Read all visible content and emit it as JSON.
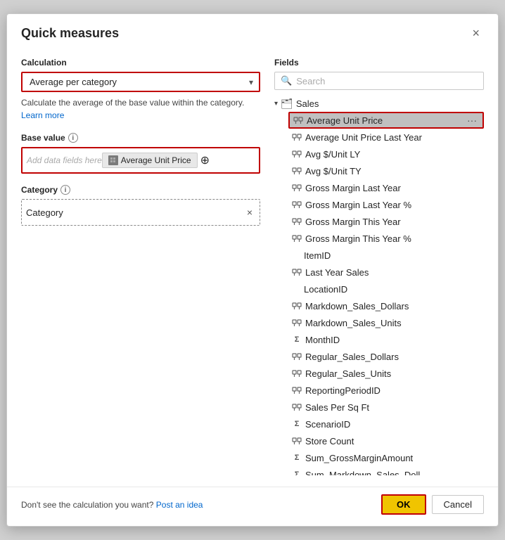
{
  "dialog": {
    "title": "Quick measures",
    "close_label": "×"
  },
  "left": {
    "calculation_label": "Calculation",
    "calculation_value": "Average per category",
    "description": "Calculate the average of the base value within the category.",
    "learn_more": "Learn more",
    "base_value_label": "Base value",
    "base_value_placeholder": "Add data fields here",
    "base_value_chip": "Average Unit Price",
    "category_label": "Category",
    "category_value": "Category"
  },
  "right": {
    "fields_label": "Fields",
    "search_placeholder": "Search",
    "tree": {
      "parent_label": "Sales",
      "items": [
        {
          "id": "avg-unit-price",
          "label": "Average Unit Price",
          "type": "measure",
          "selected": true,
          "show_menu": true
        },
        {
          "id": "avg-unit-price-ly",
          "label": "Average Unit Price Last Year",
          "type": "measure",
          "selected": false
        },
        {
          "id": "avg-s-unit-ly",
          "label": "Avg $/Unit LY",
          "type": "measure",
          "selected": false
        },
        {
          "id": "avg-s-unit-ty",
          "label": "Avg $/Unit TY",
          "type": "measure",
          "selected": false
        },
        {
          "id": "gross-margin-ly",
          "label": "Gross Margin Last Year",
          "type": "measure",
          "selected": false
        },
        {
          "id": "gross-margin-ly-pct",
          "label": "Gross Margin Last Year %",
          "type": "measure",
          "selected": false
        },
        {
          "id": "gross-margin-ty",
          "label": "Gross Margin This Year",
          "type": "measure",
          "selected": false
        },
        {
          "id": "gross-margin-ty-pct",
          "label": "Gross Margin This Year %",
          "type": "measure",
          "selected": false
        },
        {
          "id": "itemid",
          "label": "ItemID",
          "type": "none",
          "selected": false
        },
        {
          "id": "last-year-sales",
          "label": "Last Year Sales",
          "type": "measure",
          "selected": false
        },
        {
          "id": "locationid",
          "label": "LocationID",
          "type": "none",
          "selected": false
        },
        {
          "id": "markdown-sales-dollars",
          "label": "Markdown_Sales_Dollars",
          "type": "measure",
          "selected": false
        },
        {
          "id": "markdown-sales-units",
          "label": "Markdown_Sales_Units",
          "type": "measure",
          "selected": false
        },
        {
          "id": "monthid",
          "label": "MonthID",
          "type": "sigma",
          "selected": false
        },
        {
          "id": "regular-sales-dollars",
          "label": "Regular_Sales_Dollars",
          "type": "measure",
          "selected": false
        },
        {
          "id": "regular-sales-units",
          "label": "Regular_Sales_Units",
          "type": "measure",
          "selected": false
        },
        {
          "id": "reporting-period-id",
          "label": "ReportingPeriodID",
          "type": "measure-alt",
          "selected": false
        },
        {
          "id": "sales-per-sq-ft",
          "label": "Sales Per Sq Ft",
          "type": "measure",
          "selected": false
        },
        {
          "id": "scenarioid",
          "label": "ScenarioID",
          "type": "sigma",
          "selected": false
        },
        {
          "id": "store-count",
          "label": "Store Count",
          "type": "measure",
          "selected": false
        },
        {
          "id": "sum-gross-margin",
          "label": "Sum_GrossMarginAmount",
          "type": "sigma",
          "selected": false
        },
        {
          "id": "sum-margin-sales",
          "label": "Sum_Markdown_Sales_Doll...",
          "type": "sigma",
          "selected": false
        }
      ]
    }
  },
  "footer": {
    "left_text": "Don't see the calculation you want?",
    "link_text": "Post an idea",
    "ok_label": "OK",
    "cancel_label": "Cancel"
  }
}
